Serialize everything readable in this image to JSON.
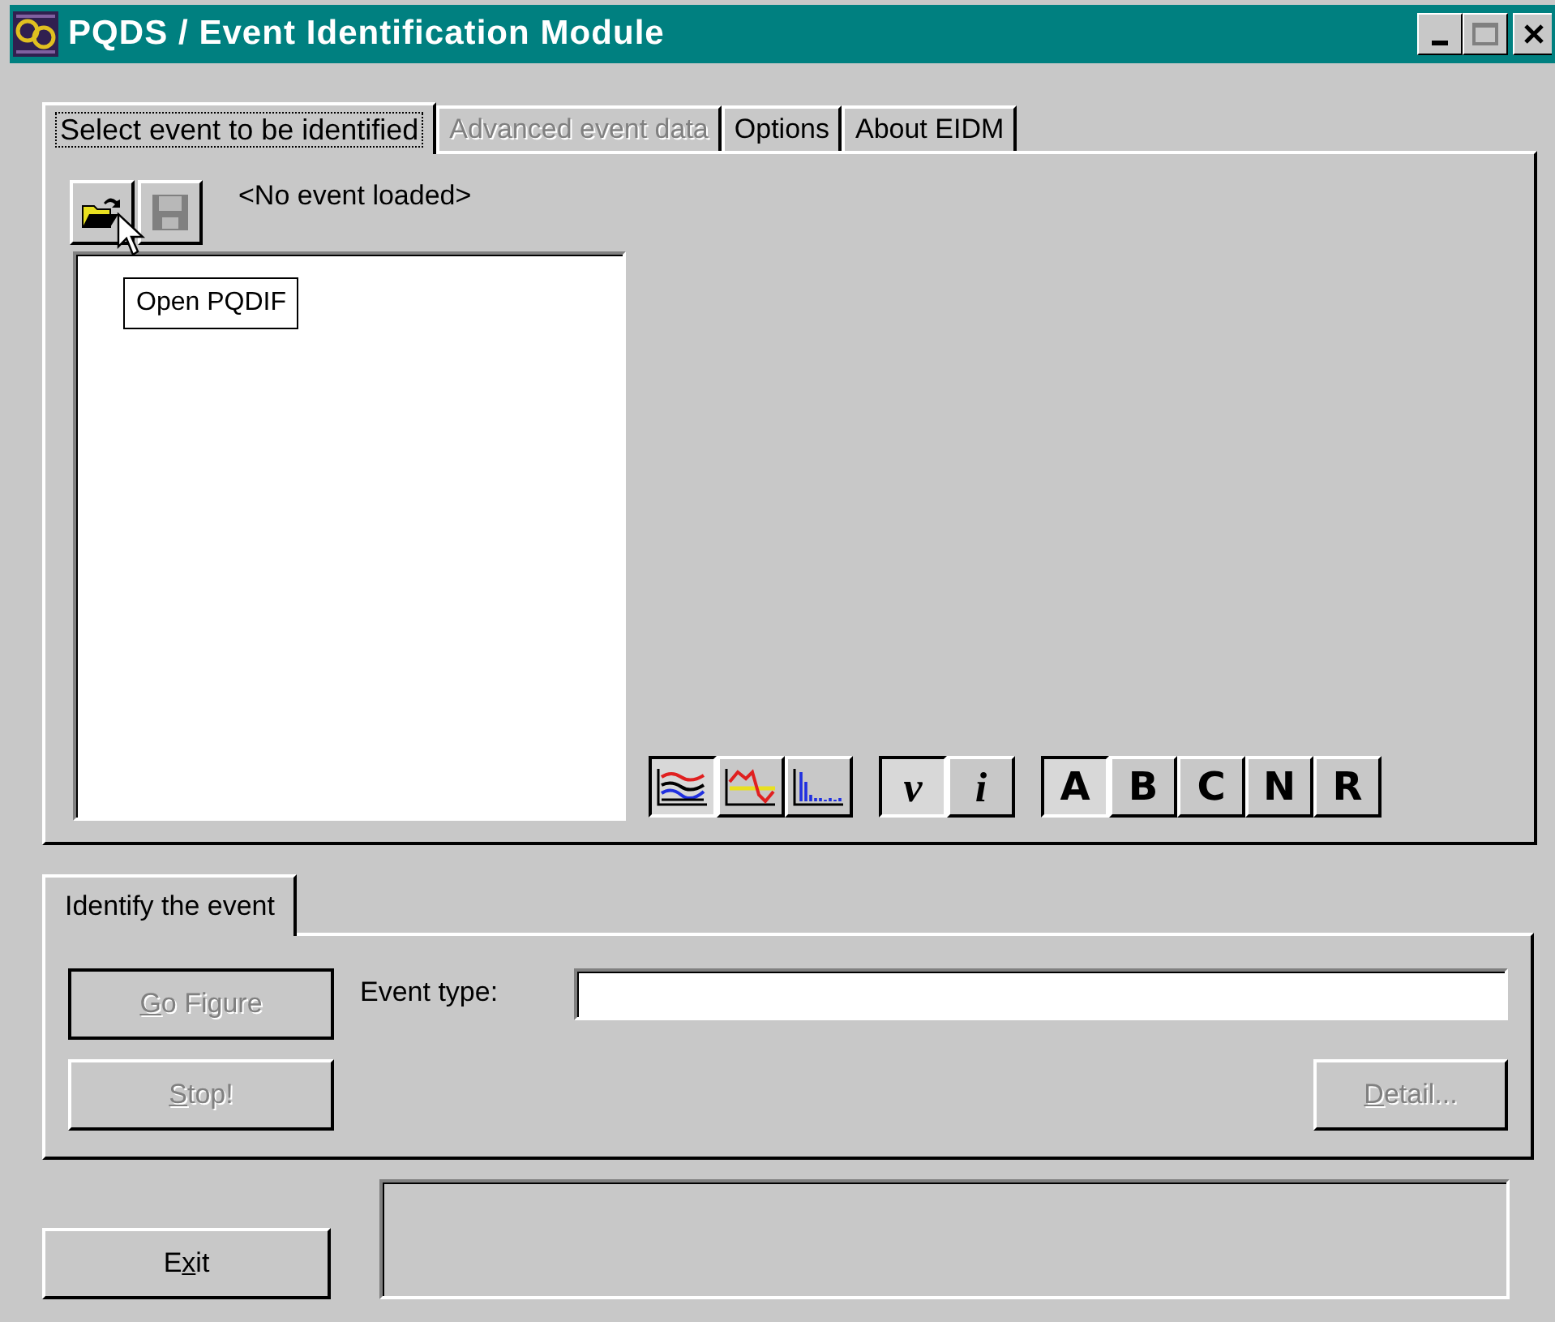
{
  "window": {
    "title": "PQDS / Event Identification Module"
  },
  "tabs": [
    {
      "label": "Select event to be identified",
      "selected": true,
      "disabled": false
    },
    {
      "label": "Advanced event data",
      "selected": false,
      "disabled": true
    },
    {
      "label": "Options",
      "selected": false,
      "disabled": false
    },
    {
      "label": "About EIDM",
      "selected": false,
      "disabled": false
    }
  ],
  "toolbar": [
    {
      "kind": "open",
      "disabled": false
    },
    {
      "kind": "save",
      "disabled": true
    }
  ],
  "event_status": "<No event loaded>",
  "tooltip": "Open PQDIF",
  "view_buttons": [
    {
      "kind": "waveform",
      "selected": true
    },
    {
      "kind": "rms",
      "selected": false
    },
    {
      "kind": "spectrum",
      "selected": false
    }
  ],
  "quantity_buttons": [
    {
      "label": "v",
      "selected": true
    },
    {
      "label": "i",
      "selected": false
    }
  ],
  "phase_buttons": [
    {
      "label": "A",
      "selected": true
    },
    {
      "label": "B",
      "selected": false
    },
    {
      "label": "C",
      "selected": false
    },
    {
      "label": "N",
      "selected": false
    },
    {
      "label": "R",
      "selected": false
    }
  ],
  "identify_tab": {
    "label": "Identify the event",
    "selected": true
  },
  "go_button": {
    "label_parts": [
      {
        "text": "G",
        "underlined": true
      },
      {
        "text": "o Figure",
        "underlined": false
      }
    ],
    "disabled": true
  },
  "stop_button": {
    "label_parts": [
      {
        "text": "S",
        "underlined": true
      },
      {
        "text": "top!",
        "underlined": false
      }
    ],
    "disabled": true
  },
  "event_type": {
    "label": "Event type:"
  },
  "detail_button": {
    "label_parts": [
      {
        "text": "D",
        "underlined": true
      },
      {
        "text": "etail...",
        "underlined": false
      }
    ],
    "disabled": true
  },
  "exit_button": {
    "label_parts": [
      {
        "text": "E",
        "underlined": false
      },
      {
        "text": "x",
        "underlined": true
      },
      {
        "text": "it",
        "underlined": false
      }
    ],
    "disabled": false
  }
}
